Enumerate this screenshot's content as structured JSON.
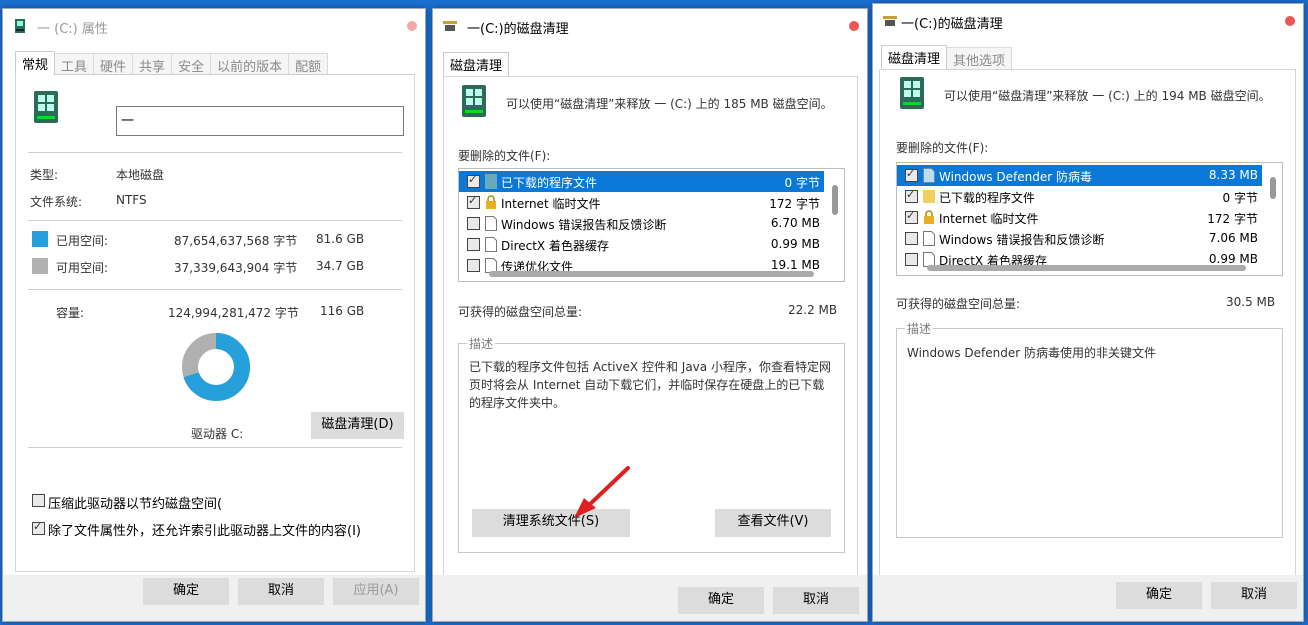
{
  "colors": {
    "accent": "#0a78d7",
    "used": "#26a0da",
    "free": "#b0b0b0",
    "background": "#1b6fd1"
  },
  "win1": {
    "title": "一 (C:) 属性",
    "tabs": [
      "常规",
      "工具",
      "硬件",
      "共享",
      "安全",
      "以前的版本",
      "配额"
    ],
    "name_value": "一",
    "type_label": "类型:",
    "type_value": "本地磁盘",
    "fs_label": "文件系统:",
    "fs_value": "NTFS",
    "used_label": "已用空间:",
    "used_bytes": "87,654,637,568 字节",
    "used_gb": "81.6 GB",
    "free_label": "可用空间:",
    "free_bytes": "37,339,643,904 字节",
    "free_gb": "34.7 GB",
    "cap_label": "容量:",
    "cap_bytes": "124,994,281,472 字节",
    "cap_gb": "116 GB",
    "used_fraction": 0.7,
    "drive_label": "驱动器 C:",
    "cleanup_button": "磁盘清理(D)",
    "compress_label": "压缩此驱动器以节约磁盘空间(",
    "index_label": "除了文件属性外，还允许索引此驱动器上文件的内容(I)",
    "ok": "确定",
    "cancel": "取消",
    "apply": "应用(A)"
  },
  "win2": {
    "title": "一(C:)的磁盘清理",
    "tab": "磁盘清理",
    "intro": "可以使用“磁盘清理”来释放 一 (C:) 上的 185 MB 磁盘空间。",
    "files_label": "要删除的文件(F):",
    "files": [
      {
        "name": "已下载的程序文件",
        "size": "0 字节",
        "checked": true,
        "selected": true,
        "icon": "folder-icon"
      },
      {
        "name": "Internet 临时文件",
        "size": "172 字节",
        "checked": true,
        "selected": false,
        "icon": "lock-icon"
      },
      {
        "name": "Windows 错误报告和反馈诊断",
        "size": "6.70 MB",
        "checked": false,
        "selected": false,
        "icon": "file-icon"
      },
      {
        "name": "DirectX 着色器缓存",
        "size": "0.99 MB",
        "checked": false,
        "selected": false,
        "icon": "file-icon"
      },
      {
        "name": "传递优化文件",
        "size": "19.1 MB",
        "checked": false,
        "selected": false,
        "icon": "file-icon"
      }
    ],
    "total_label": "可获得的磁盘空间总量:",
    "total_value": "22.2 MB",
    "desc_label": "描述",
    "desc_text": "已下载的程序文件包括 ActiveX 控件和 Java 小程序，你查看特定网页时将会从 Internet 自动下载它们，并临时保存在硬盘上的已下载的程序文件夹中。",
    "clean_sys_button": "清理系统文件(S)",
    "view_files_button": "查看文件(V)",
    "ok": "确定",
    "cancel": "取消"
  },
  "win3": {
    "title": "一(C:)的磁盘清理",
    "tabs": [
      "磁盘清理",
      "其他选项"
    ],
    "intro": "可以使用“磁盘清理”来释放 一 (C:) 上的 194 MB 磁盘空间。",
    "files_label": "要删除的文件(F):",
    "files": [
      {
        "name": "Windows Defender 防病毒",
        "size": "8.33 MB",
        "checked": true,
        "selected": true,
        "icon": "file-icon"
      },
      {
        "name": "已下载的程序文件",
        "size": "0 字节",
        "checked": true,
        "selected": false,
        "icon": "folder-icon"
      },
      {
        "name": "Internet 临时文件",
        "size": "172 字节",
        "checked": true,
        "selected": false,
        "icon": "lock-icon"
      },
      {
        "name": "Windows 错误报告和反馈诊断",
        "size": "7.06 MB",
        "checked": false,
        "selected": false,
        "icon": "file-icon"
      },
      {
        "name": "DirectX 着色器缓存",
        "size": "0.99 MB",
        "checked": false,
        "selected": false,
        "icon": "file-icon"
      }
    ],
    "total_label": "可获得的磁盘空间总量:",
    "total_value": "30.5 MB",
    "desc_label": "描述",
    "desc_text": "Windows Defender 防病毒使用的非关键文件",
    "ok": "确定",
    "cancel": "取消"
  }
}
